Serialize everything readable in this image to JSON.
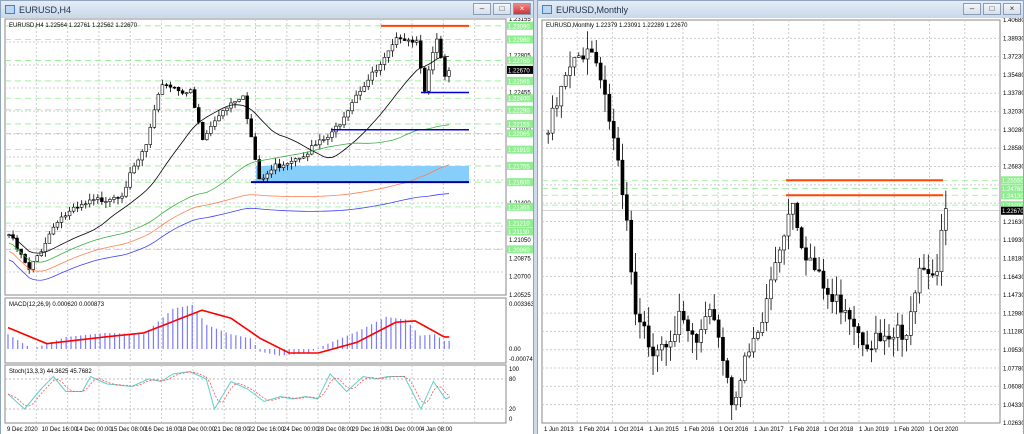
{
  "left_window": {
    "title": "EURUSD,H4",
    "info": "EURUSD,H4  1.22564 1.22761 1.22562 1.22670",
    "macd_label": "MACD(12,26,9) 0.000620 0.000873",
    "stoch_label": "Stoch(13,3,3) 44.3625 45.7682",
    "macd_axis": [
      "0.003363",
      "0.00",
      "-0.000749"
    ],
    "stoch_axis": [
      "100",
      "80",
      "20",
      "0"
    ],
    "current_price": "1.22670",
    "price_axis": [
      "1.23155",
      "1.22805",
      "1.22455",
      "1.22100",
      "1.21750",
      "1.21400",
      "1.21050",
      "1.20875",
      "1.20700",
      "1.20525"
    ],
    "level_labels": [
      "1.23090",
      "1.22960",
      "1.22760",
      "1.22565",
      "1.22400",
      "1.22290",
      "1.22155",
      "1.22065",
      "1.21910",
      "1.21755",
      "1.21600",
      "1.21365",
      "1.21210",
      "1.21130",
      "1.20960"
    ],
    "time_axis": [
      "9 Dec 2020",
      "10 Dec 16:00",
      "14 Dec 00:00",
      "15 Dec 08:00",
      "16 Dec 16:00",
      "18 Dec 00:00",
      "21 Dec 08:00",
      "22 Dec 16:00",
      "24 Dec 00:00",
      "28 Dec 08:00",
      "29 Dec 16:00",
      "31 Dec 00:00",
      "4 Jan 08:00"
    ]
  },
  "right_window": {
    "title": "EURUSD,Monthly",
    "info": "EURUSD,Monthly  1.22379 1.23091 1.22289 1.22670",
    "current_price": "1.22670",
    "price_axis": [
      "1.40680",
      "1.38930",
      "1.37230",
      "1.35480",
      "1.33780",
      "1.32030",
      "1.30280",
      "1.28580",
      "1.26830",
      "1.21630",
      "1.19930",
      "1.18180",
      "1.16430",
      "1.14730",
      "1.12980",
      "1.11280",
      "1.09530",
      "1.07780",
      "1.06080",
      "1.04330",
      "1.02630"
    ],
    "level_labels": [
      "1.25550",
      "1.24760",
      "1.24130",
      "1.23200"
    ],
    "time_axis": [
      "1 Jun 2013",
      "1 Feb 2014",
      "1 Oct 2014",
      "1 Jun 2015",
      "1 Feb 2016",
      "1 Oct 2016",
      "1 Jun 2017",
      "1 Feb 2018",
      "1 Oct 2018",
      "1 Jun 2019",
      "1 Feb 2020",
      "1 Oct 2020"
    ]
  },
  "colors": {
    "bull": "#ffffff",
    "bear": "#000000",
    "resistance": "#ff4500",
    "support": "#0000cd",
    "zone": "#87cefa",
    "level": "#90ee90",
    "macd_hist": "#7b7bff",
    "macd_signal": "#ff0000",
    "stoch_main": "#5fd0c8",
    "stoch_signal": "#ff5050"
  },
  "chart_data": [
    {
      "type": "candlestick",
      "symbol": "EURUSD",
      "timeframe": "H4",
      "ylim": [
        1.20525,
        1.23155
      ],
      "candles": 110,
      "close_path": [
        [
          0,
          1.211
        ],
        [
          5,
          1.2075
        ],
        [
          12,
          1.2125
        ],
        [
          20,
          1.214
        ],
        [
          28,
          1.215
        ],
        [
          34,
          1.2195
        ],
        [
          38,
          1.2255
        ],
        [
          45,
          1.2245
        ],
        [
          48,
          1.22
        ],
        [
          53,
          1.223
        ],
        [
          58,
          1.2245
        ],
        [
          62,
          1.216
        ],
        [
          66,
          1.2175
        ],
        [
          74,
          1.219
        ],
        [
          80,
          1.2205
        ],
        [
          86,
          1.2245
        ],
        [
          92,
          1.227
        ],
        [
          97,
          1.23
        ],
        [
          101,
          1.2295
        ],
        [
          103,
          1.225
        ],
        [
          106,
          1.2295
        ],
        [
          108,
          1.2258
        ],
        [
          110,
          1.2267
        ]
      ],
      "levels": {
        "resistance": 1.2309,
        "support": [
          1.22455,
          1.221
        ],
        "zone": [
          1.216,
          1.21755
        ]
      }
    },
    {
      "type": "candlestick",
      "symbol": "EURUSD",
      "timeframe": "Monthly",
      "ylim": [
        1.0263,
        1.4068
      ],
      "candles": 92,
      "close_path": [
        [
          0,
          1.3
        ],
        [
          4,
          1.35
        ],
        [
          9,
          1.385
        ],
        [
          12,
          1.36
        ],
        [
          15,
          1.29
        ],
        [
          18,
          1.21
        ],
        [
          20,
          1.12
        ],
        [
          24,
          1.1
        ],
        [
          30,
          1.12
        ],
        [
          34,
          1.1
        ],
        [
          38,
          1.13
        ],
        [
          42,
          1.05
        ],
        [
          44,
          1.07
        ],
        [
          49,
          1.12
        ],
        [
          52,
          1.18
        ],
        [
          56,
          1.24
        ],
        [
          58,
          1.2
        ],
        [
          62,
          1.16
        ],
        [
          65,
          1.14
        ],
        [
          68,
          1.14
        ],
        [
          72,
          1.11
        ],
        [
          77,
          1.1
        ],
        [
          80,
          1.11
        ],
        [
          81,
          1.1
        ],
        [
          85,
          1.18
        ],
        [
          89,
          1.17
        ],
        [
          91,
          1.227
        ]
      ],
      "levels": {
        "resistance": [
          1.2555,
          1.2413
        ]
      }
    },
    {
      "type": "line",
      "name": "MACD(12,26,9)",
      "hist_path": [
        [
          0,
          0.0011
        ],
        [
          5,
          0
        ],
        [
          12,
          0.0009
        ],
        [
          20,
          0.0012
        ],
        [
          28,
          0.0011
        ],
        [
          34,
          0.003
        ],
        [
          38,
          0.0033
        ],
        [
          41,
          0.0018
        ],
        [
          46,
          0.0011
        ],
        [
          50,
          0.0008
        ],
        [
          52,
          -0.0002
        ],
        [
          56,
          -0.0005
        ],
        [
          62,
          -0.0003
        ],
        [
          66,
          0.0004
        ],
        [
          72,
          0.0013
        ],
        [
          78,
          0.0024
        ],
        [
          82,
          0.0022
        ],
        [
          85,
          0.001
        ],
        [
          88,
          0.0011
        ],
        [
          90,
          0.0006
        ]
      ],
      "signal_path": [
        [
          0,
          0.0016
        ],
        [
          8,
          0.0004
        ],
        [
          20,
          0.0009
        ],
        [
          28,
          0.0012
        ],
        [
          40,
          0.0029
        ],
        [
          46,
          0.0023
        ],
        [
          52,
          0.0008
        ],
        [
          58,
          -0.0003
        ],
        [
          64,
          -0.0003
        ],
        [
          72,
          0.0005
        ],
        [
          80,
          0.002
        ],
        [
          84,
          0.0021
        ],
        [
          90,
          0.0009
        ]
      ]
    },
    {
      "type": "line",
      "name": "Stoch(13,3,3)",
      "main_path": [
        [
          0,
          50
        ],
        [
          4,
          20
        ],
        [
          8,
          60
        ],
        [
          11,
          85
        ],
        [
          14,
          55
        ],
        [
          18,
          55
        ],
        [
          20,
          85
        ],
        [
          24,
          70
        ],
        [
          30,
          65
        ],
        [
          34,
          80
        ],
        [
          37,
          75
        ],
        [
          40,
          90
        ],
        [
          44,
          95
        ],
        [
          48,
          80
        ],
        [
          50,
          20
        ],
        [
          54,
          75
        ],
        [
          58,
          60
        ],
        [
          62,
          35
        ],
        [
          66,
          45
        ],
        [
          69,
          40
        ],
        [
          72,
          45
        ],
        [
          75,
          40
        ],
        [
          78,
          90
        ],
        [
          82,
          55
        ],
        [
          86,
          85
        ],
        [
          89,
          80
        ],
        [
          92,
          85
        ],
        [
          96,
          85
        ],
        [
          100,
          20
        ],
        [
          103,
          75
        ],
        [
          106,
          40
        ],
        [
          107,
          44
        ]
      ]
    }
  ]
}
